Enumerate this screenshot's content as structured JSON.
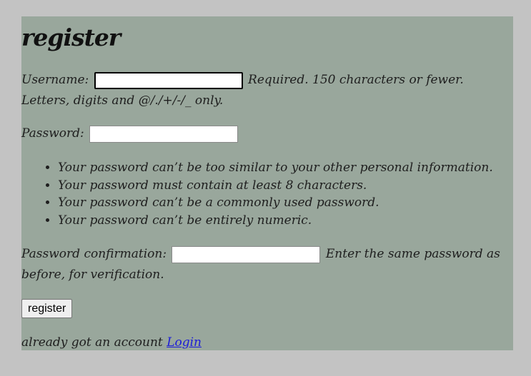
{
  "page": {
    "title": "register"
  },
  "username": {
    "label": "Username:",
    "value": "",
    "help": "Required. 150 characters or fewer. Letters, digits and @/./+/-/_ only."
  },
  "password": {
    "label": "Password:",
    "value": "",
    "rules": [
      "Your password can’t be too similar to your other personal information.",
      "Your password must contain at least 8 characters.",
      "Your password can’t be a commonly used password.",
      "Your password can’t be entirely numeric."
    ]
  },
  "password_confirmation": {
    "label": "Password confirmation:",
    "value": "",
    "help": "Enter the same password as before, for verification."
  },
  "form": {
    "submit_label": "register"
  },
  "footer": {
    "text": "already got an account",
    "login_link": "Login"
  },
  "colors": {
    "page_background": "#c3c3c3",
    "panel_background": "#99a79c",
    "link": "#1c1cd8"
  }
}
